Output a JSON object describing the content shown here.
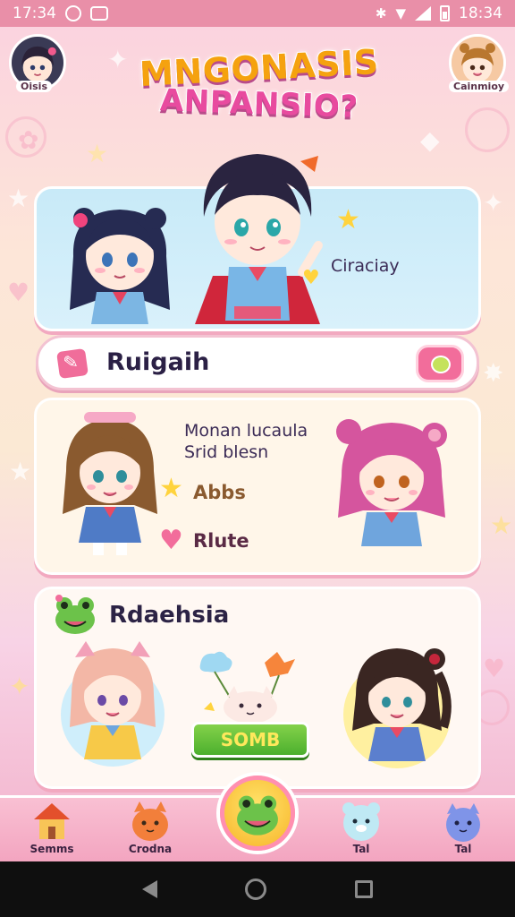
{
  "status_bar": {
    "time_left": "17:34",
    "time_right": "18:34"
  },
  "header": {
    "avatar_left_label": "Oisis",
    "avatar_right_label": "Cainmioy",
    "title_line1": "MNGONASIS",
    "title_line2": "ANPANSIO?"
  },
  "card1": {
    "caption": "Ciraciay"
  },
  "search_row": {
    "label": "Ruigaih"
  },
  "card2": {
    "text_line1": "Monan lucaula",
    "text_line2": "Srid blesn",
    "item1": "Abbs",
    "item2": "Rlute"
  },
  "card3": {
    "label": "Rdaehsia",
    "button_label": "SOMB"
  },
  "bottom_nav": {
    "items": [
      {
        "label": "Semms",
        "icon": "house-icon"
      },
      {
        "label": "Crodna",
        "icon": "cat-icon"
      },
      {
        "label": "",
        "icon": "frog-icon"
      },
      {
        "label": "Tal",
        "icon": "bear-icon"
      },
      {
        "label": "Tal",
        "icon": "cat-blue-icon"
      }
    ]
  },
  "colors": {
    "status_bar": "#e98fa8",
    "accent_pink": "#f26d9b",
    "title_orange": "#f5a20f",
    "title_pink": "#e84b9f",
    "go_button": "#4caf2e"
  }
}
